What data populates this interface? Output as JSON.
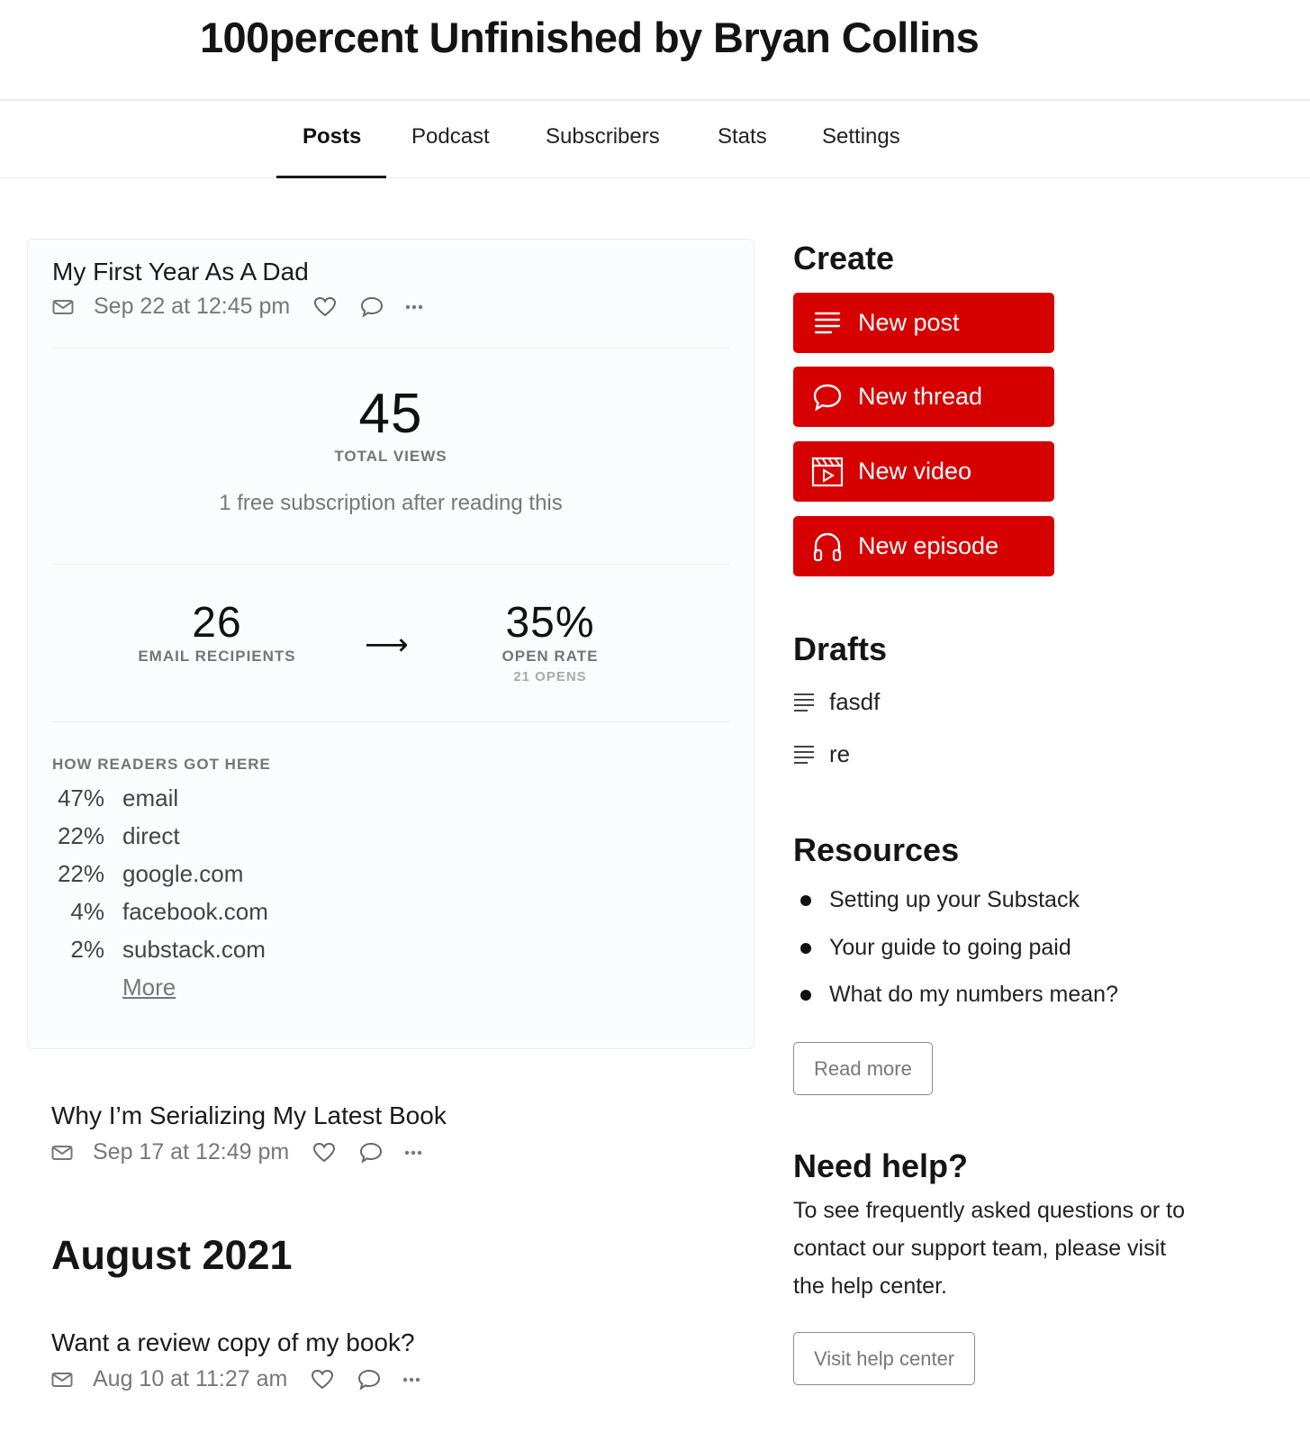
{
  "publication": {
    "title": "100percent Unfinished by Bryan Collins"
  },
  "nav": {
    "tabs": [
      {
        "label": "Posts",
        "active": true
      },
      {
        "label": "Podcast",
        "active": false
      },
      {
        "label": "Subscribers",
        "active": false
      },
      {
        "label": "Stats",
        "active": false
      },
      {
        "label": "Settings",
        "active": false
      }
    ]
  },
  "featured_post": {
    "title": "My First Year As A Dad",
    "date": "Sep 22 at 12:45 pm",
    "icons": [
      "email-icon",
      "heart-icon",
      "comment-icon",
      "more-icon"
    ],
    "total_views": "45",
    "total_views_label": "TOTAL VIEWS",
    "subscription_note": "1 free subscription after reading this",
    "email_recipients": "26",
    "email_recipients_label": "EMAIL RECIPIENTS",
    "arrow": "⟶",
    "open_rate": "35%",
    "open_rate_label": "OPEN RATE",
    "opens": "21 OPENS",
    "referrers_heading": "HOW READERS GOT HERE",
    "referrers": [
      {
        "pct": "47%",
        "source": "email"
      },
      {
        "pct": "22%",
        "source": "direct"
      },
      {
        "pct": "22%",
        "source": "google.com"
      },
      {
        "pct": "4%",
        "source": "facebook.com"
      },
      {
        "pct": "2%",
        "source": "substack.com"
      }
    ],
    "more_label": "More"
  },
  "posts": [
    {
      "title": "Why I’m Serializing My Latest Book",
      "date": "Sep 17 at 12:49 pm"
    },
    {
      "title": "Want a review copy of my book?",
      "date": "Aug 10 at 11:27 am"
    }
  ],
  "month_heading": "August 2021",
  "sidebar": {
    "create": {
      "heading": "Create",
      "buttons": [
        {
          "label": "New post",
          "icon": "post-lines-icon"
        },
        {
          "label": "New thread",
          "icon": "thread-bubble-icon"
        },
        {
          "label": "New video",
          "icon": "video-clapper-icon"
        },
        {
          "label": "New episode",
          "icon": "headphones-icon"
        }
      ]
    },
    "drafts": {
      "heading": "Drafts",
      "items": [
        {
          "label": "fasdf"
        },
        {
          "label": "re"
        }
      ]
    },
    "resources": {
      "heading": "Resources",
      "items": [
        {
          "label": "Setting up your Substack"
        },
        {
          "label": "Your guide to going paid"
        },
        {
          "label": "What do my numbers mean?"
        }
      ],
      "read_more": "Read more"
    },
    "help": {
      "heading": "Need help?",
      "text": "To see frequently asked questions or to contact our support team, please visit the help center.",
      "button": "Visit help center"
    }
  },
  "colors": {
    "accent": "#d60000",
    "card_bg": "#fbfcfd",
    "muted_text": "#777777"
  }
}
